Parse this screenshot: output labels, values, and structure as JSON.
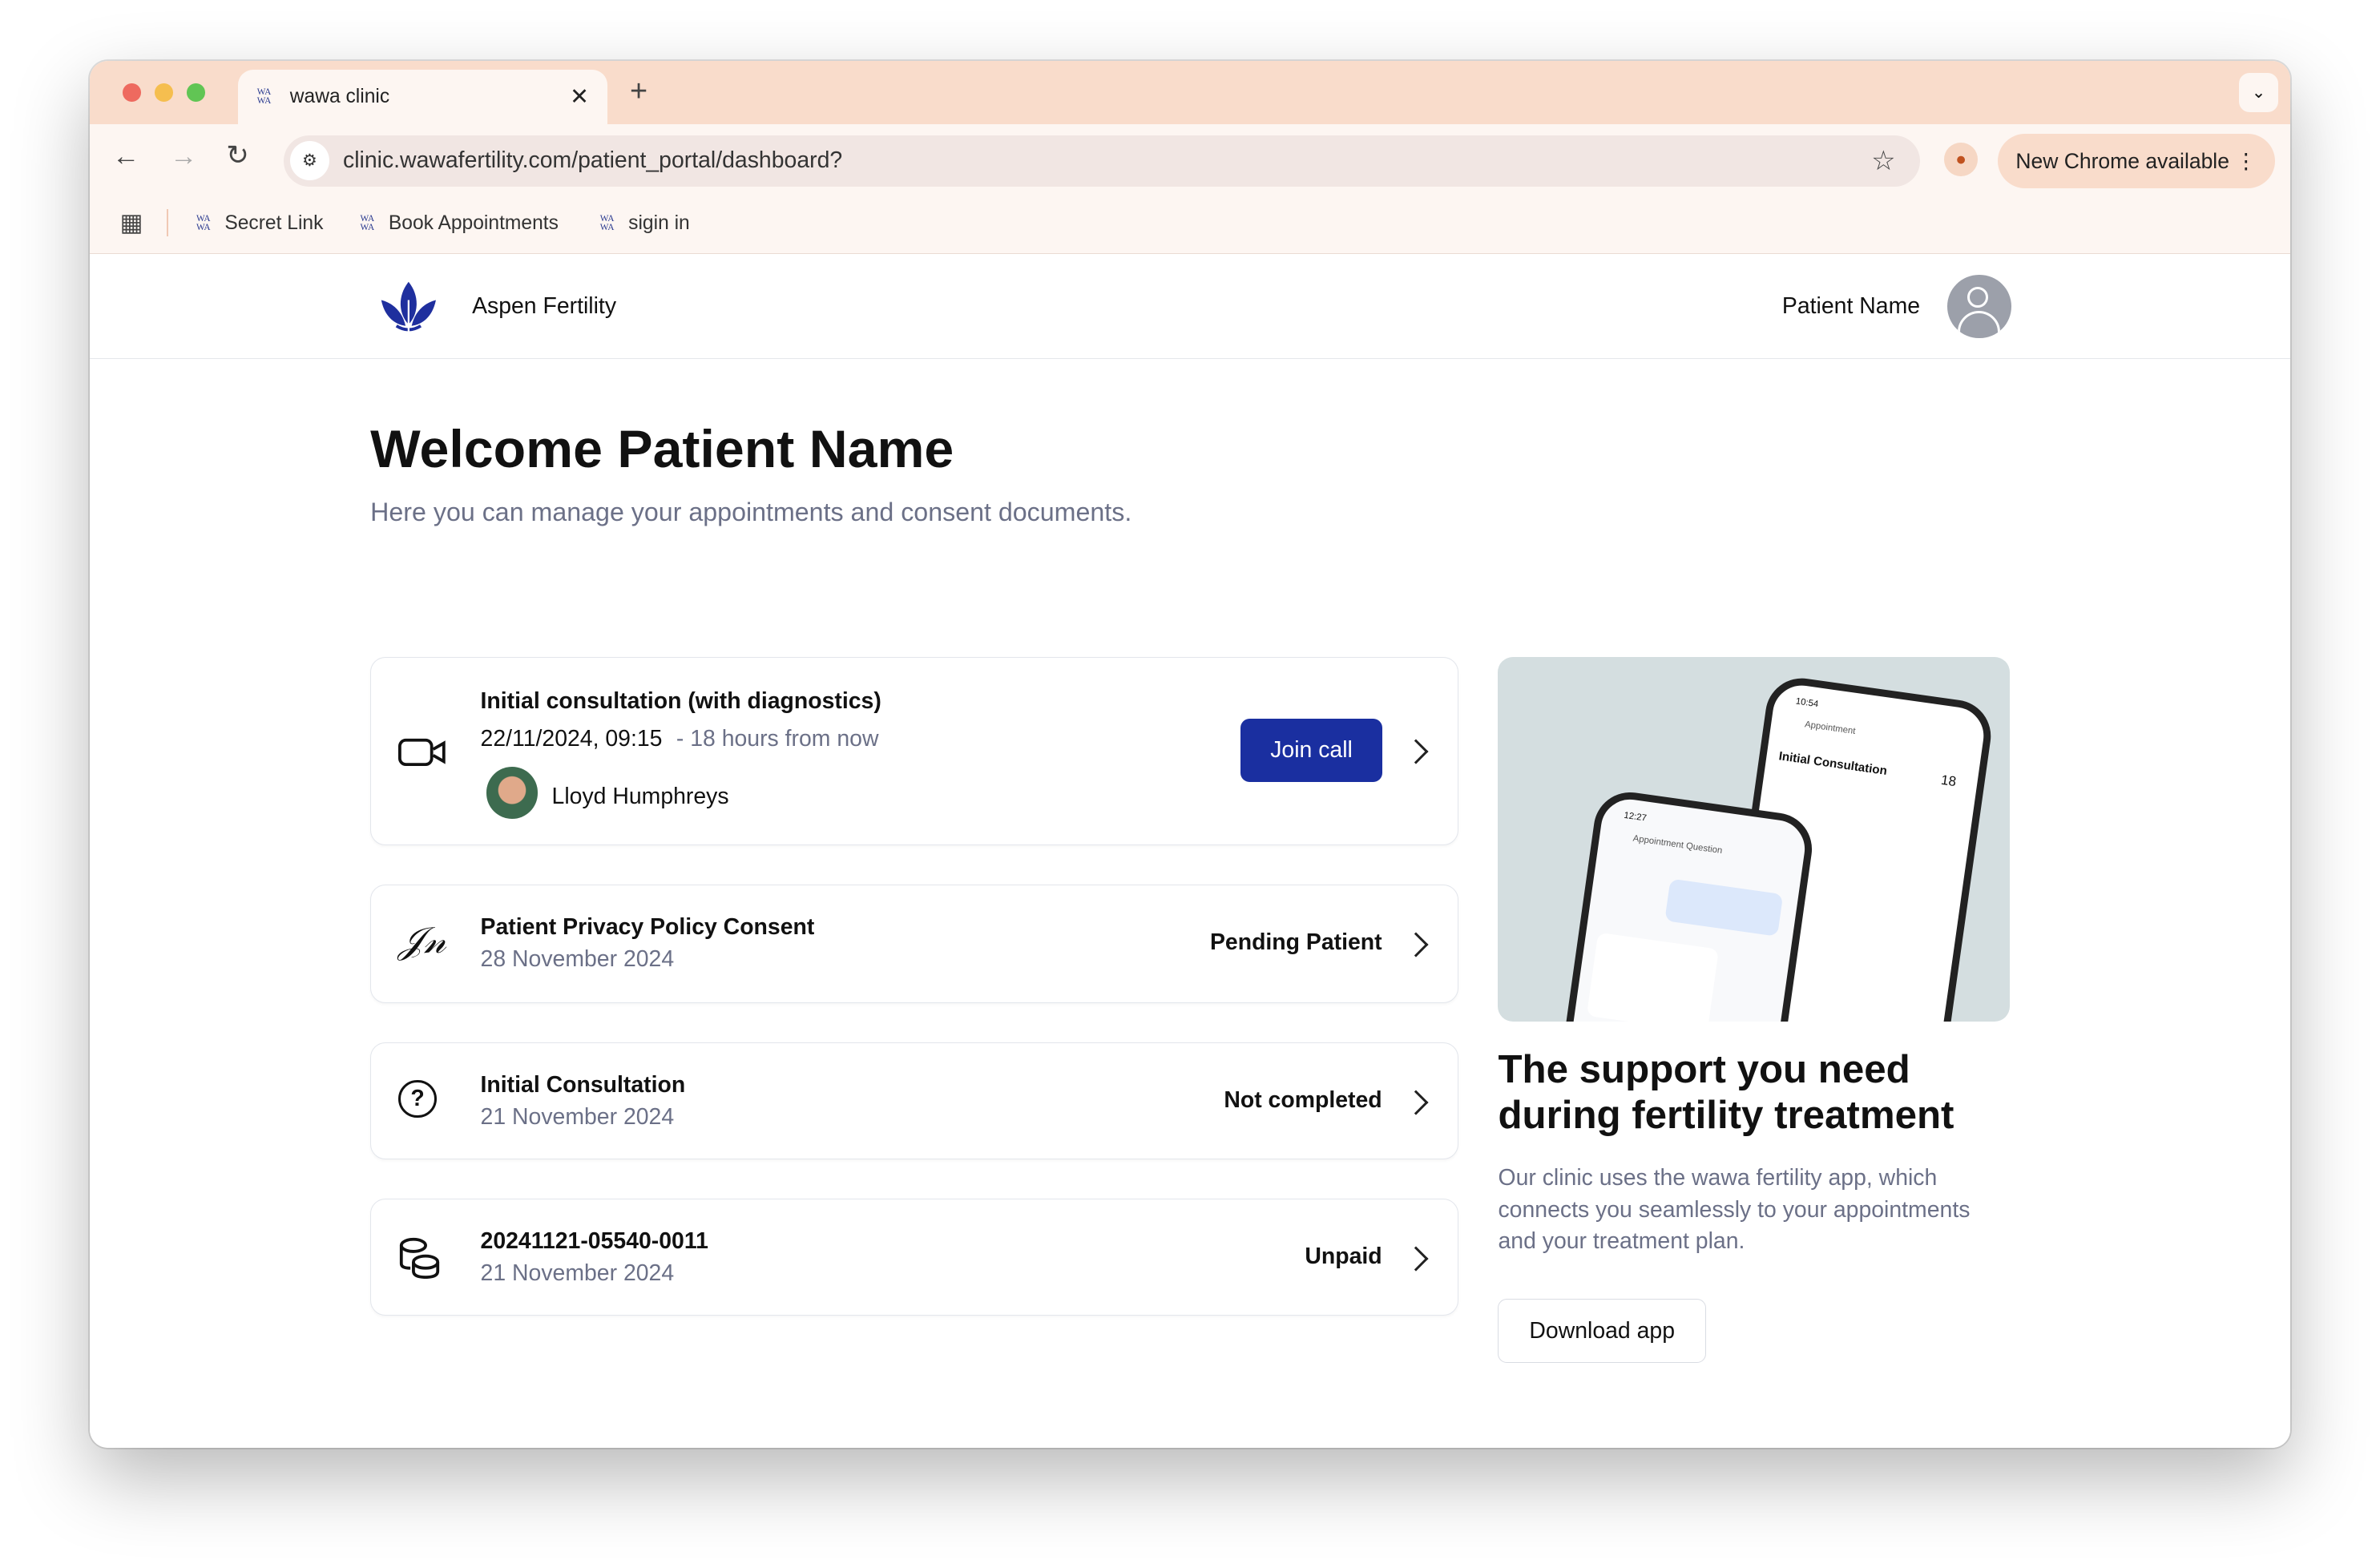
{
  "browser": {
    "tab_title": "wawa clinic",
    "url": "clinic.wawafertility.com/patient_portal/dashboard?",
    "update_label": "New Chrome available",
    "bookmarks": [
      {
        "label": "Secret Link"
      },
      {
        "label": "Book Appointments"
      },
      {
        "label": "sigin in"
      }
    ],
    "favicon_text": "WA WA"
  },
  "header": {
    "brand": "Aspen Fertility",
    "user_name": "Patient Name",
    "brand_color": "#1f2f9e"
  },
  "main": {
    "title": "Welcome Patient Name",
    "subtitle": "Here you can manage your appointments and consent documents.",
    "items": [
      {
        "icon": "video-camera-icon",
        "title": "Initial consultation (with diagnostics)",
        "datetime": "22/11/2024, 09:15",
        "relative": "- 18 hours from now",
        "practitioner": "Lloyd Humphreys",
        "action": "Join call"
      },
      {
        "icon": "signature-icon",
        "title": "Patient Privacy Policy Consent",
        "date": "28 November 2024",
        "status": "Pending Patient"
      },
      {
        "icon": "question-circle-icon",
        "title": "Initial Consultation",
        "date": "21 November 2024",
        "status": "Not completed"
      },
      {
        "icon": "coins-icon",
        "title": "20241121-05540-0011",
        "date": "21 November 2024",
        "status": "Unpaid"
      }
    ]
  },
  "promo": {
    "title": "The support you need during fertility treatment",
    "body": "Our clinic uses the wawa fertility app, which connects you seamlessly to your appointments and your treatment plan.",
    "button": "Download app",
    "phone_back": {
      "time": "10:54",
      "screen": "Appointment",
      "heading": "Initial Consultation",
      "day": "18"
    },
    "phone_front": {
      "time": "12:27",
      "screen": "Appointment Question"
    }
  },
  "colors": {
    "accent": "#1a2fa0",
    "muted": "#6b7087",
    "tabbar": "#f9dccb"
  }
}
